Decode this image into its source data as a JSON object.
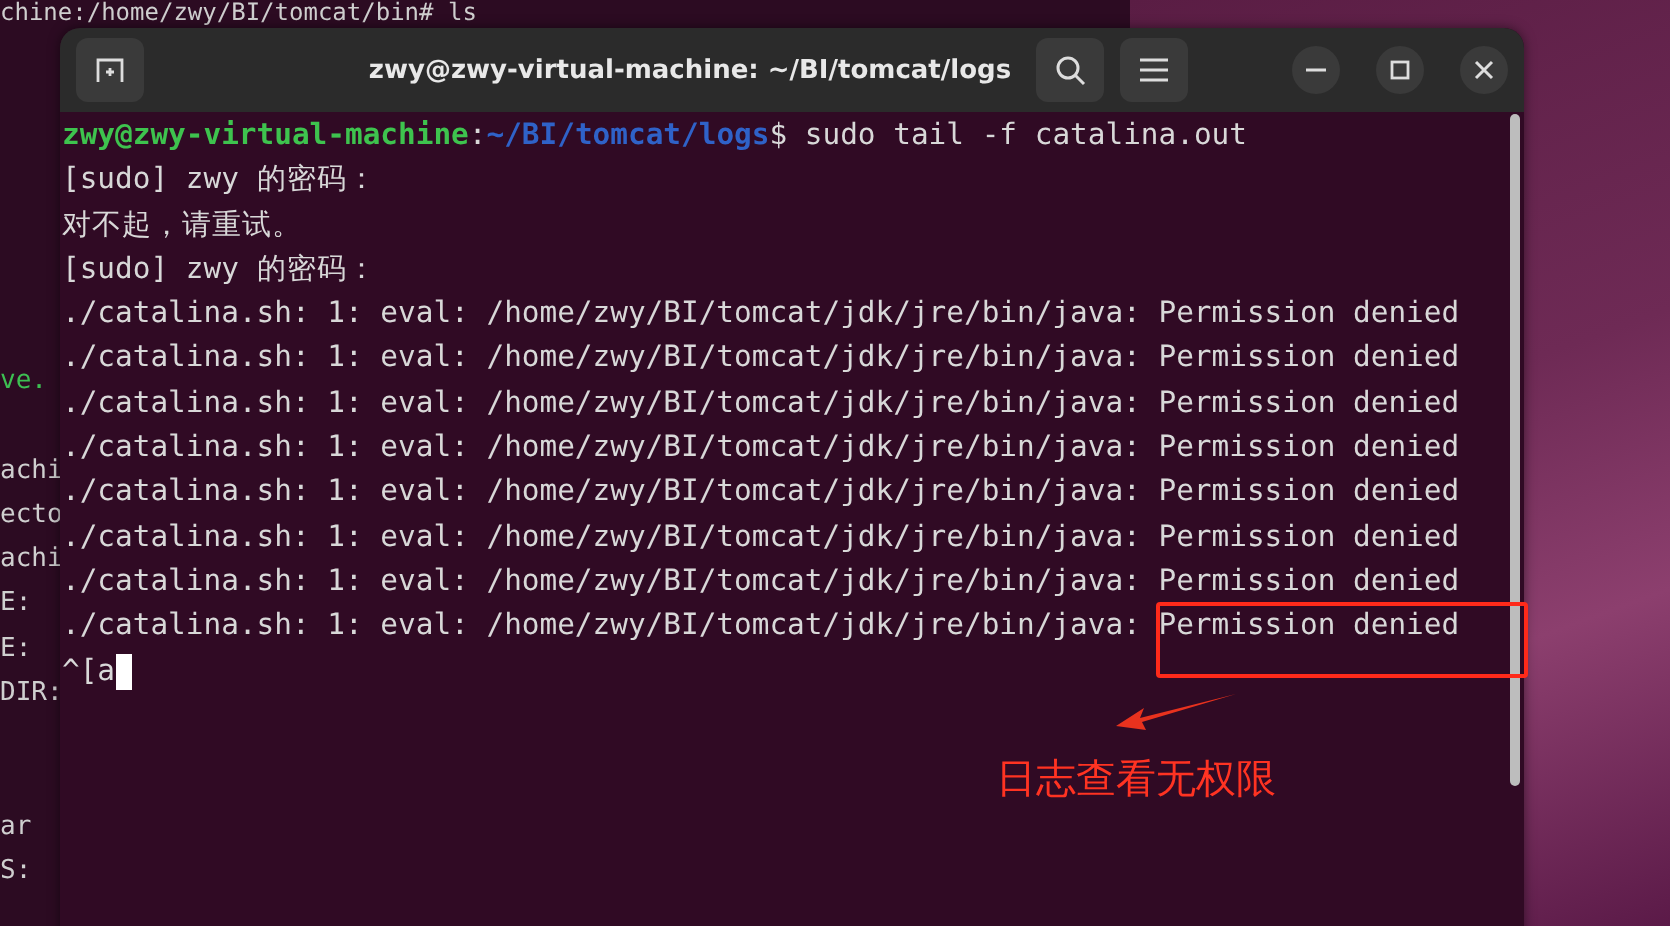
{
  "background_terminal": {
    "top_line": "chine:/home/zwy/BI/tomcat/bin# ls",
    "side_blocks": [
      [
        {
          "text": "ve.",
          "kind": "prompt"
        }
      ],
      [
        {
          "text": "achi",
          "kind": "output"
        },
        {
          "text": "ecto",
          "kind": "output"
        },
        {
          "text": "achi",
          "kind": "output"
        },
        {
          "text": "E:",
          "kind": "output"
        },
        {
          "text": "E:",
          "kind": "output"
        },
        {
          "text": "DIR:",
          "kind": "output"
        }
      ],
      [
        {
          "text": "ar",
          "kind": "output"
        },
        {
          "text": "S:",
          "kind": "output"
        }
      ]
    ]
  },
  "window": {
    "title": "zwy@zwy-virtual-machine: ~/BI/tomcat/logs",
    "prompt": {
      "user_host": "zwy@zwy-virtual-machine",
      "separator": ":",
      "path": "~/BI/tomcat/logs",
      "command": "$ sudo tail -f catalina.out"
    },
    "lines": [
      {
        "text": "[sudo] zwy 的密码：",
        "kind": "output"
      },
      {
        "text": "对不起，请重试。",
        "kind": "output"
      },
      {
        "text": "[sudo] zwy 的密码：",
        "kind": "output"
      },
      {
        "text": "./catalina.sh: 1: eval: /home/zwy/BI/tomcat/jdk/jre/bin/java: Permission denied",
        "kind": "output"
      },
      {
        "text": "./catalina.sh: 1: eval: /home/zwy/BI/tomcat/jdk/jre/bin/java: Permission denied",
        "kind": "output"
      },
      {
        "text": "./catalina.sh: 1: eval: /home/zwy/BI/tomcat/jdk/jre/bin/java: Permission denied",
        "kind": "output"
      },
      {
        "text": "./catalina.sh: 1: eval: /home/zwy/BI/tomcat/jdk/jre/bin/java: Permission denied",
        "kind": "output"
      },
      {
        "text": "./catalina.sh: 1: eval: /home/zwy/BI/tomcat/jdk/jre/bin/java: Permission denied",
        "kind": "output"
      },
      {
        "text": "./catalina.sh: 1: eval: /home/zwy/BI/tomcat/jdk/jre/bin/java: Permission denied",
        "kind": "output"
      },
      {
        "text": "./catalina.sh: 1: eval: /home/zwy/BI/tomcat/jdk/jre/bin/java: Permission denied",
        "kind": "output"
      },
      {
        "text": "./catalina.sh: 1: eval: /home/zwy/BI/tomcat/jdk/jre/bin/java: Permission denied",
        "kind": "output"
      },
      {
        "text": "^[a",
        "kind": "input"
      }
    ]
  },
  "annotation": {
    "text": "日志查看无权限"
  }
}
